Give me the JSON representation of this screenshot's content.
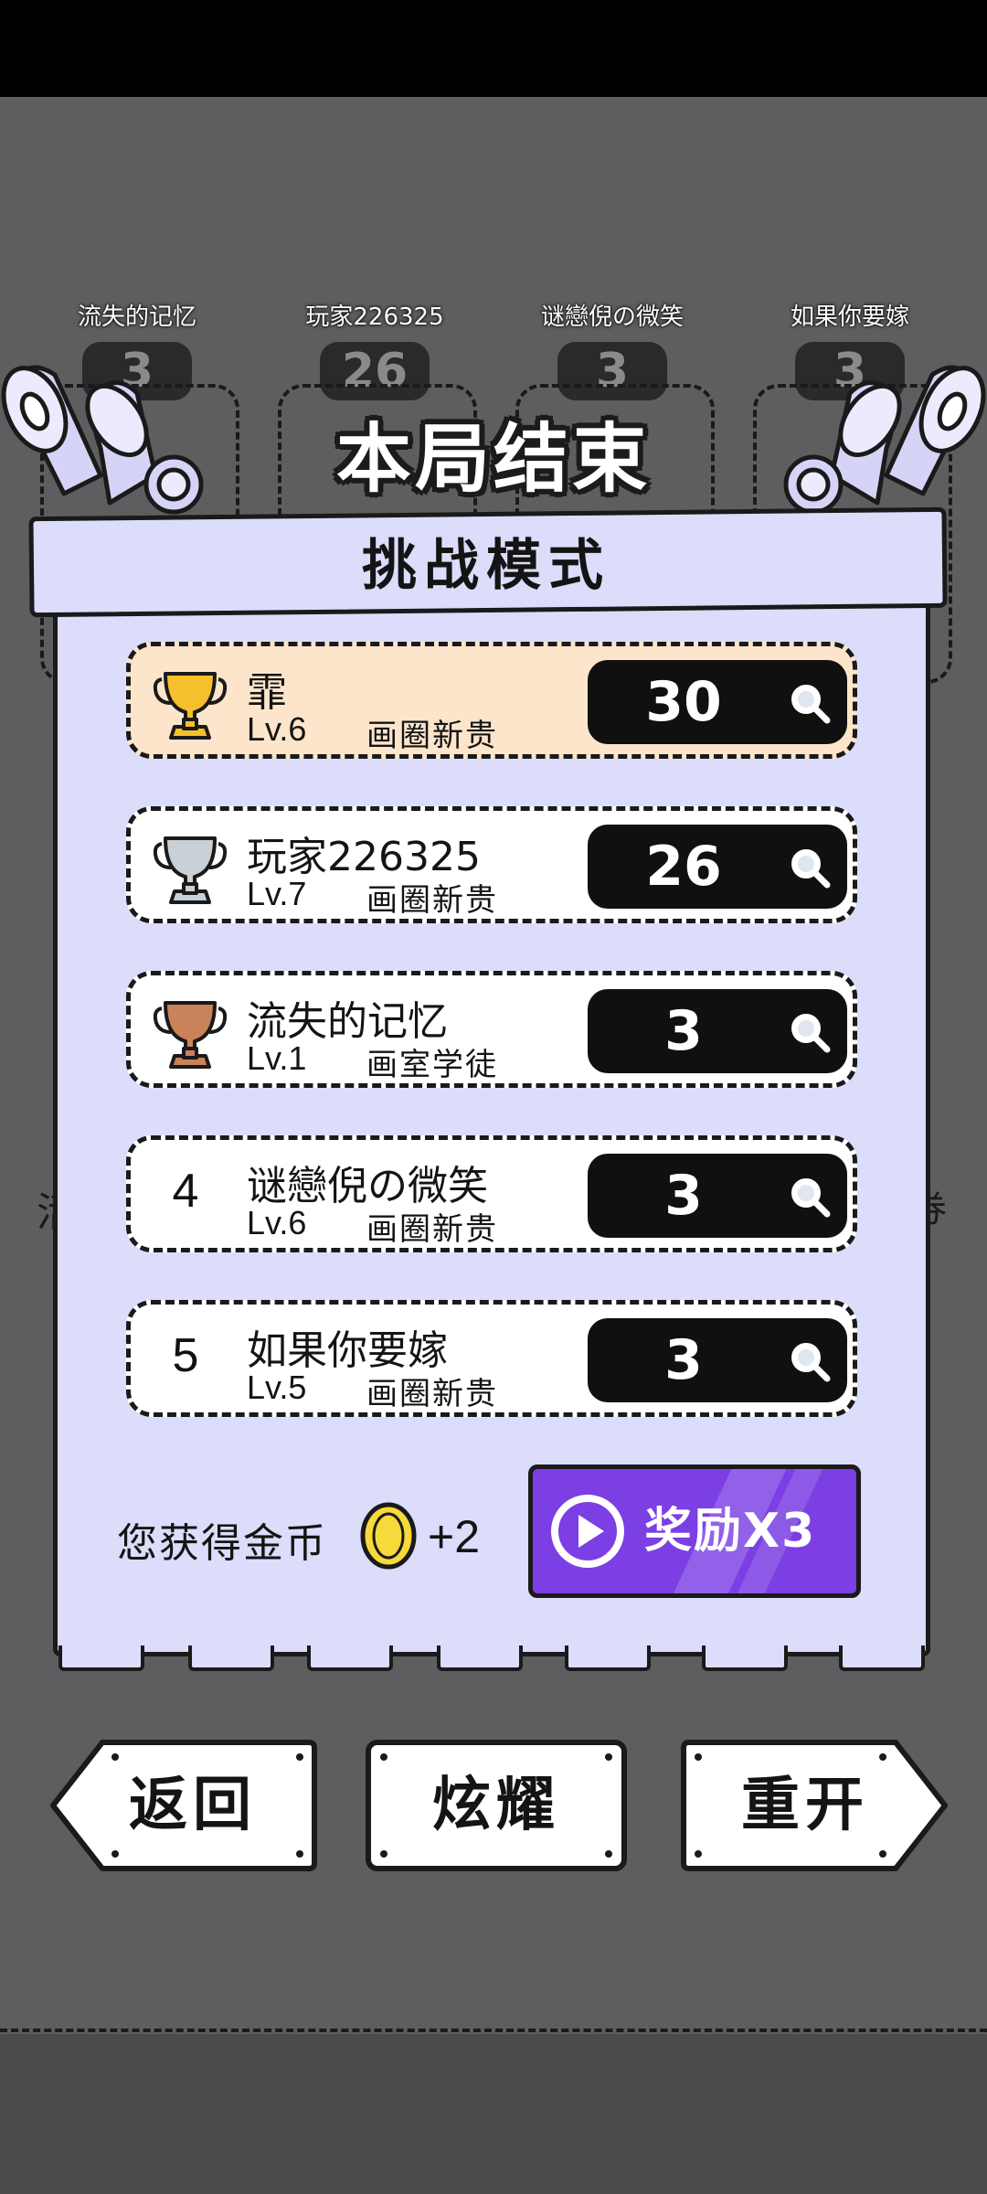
{
  "header": {
    "result_title": "本局结束"
  },
  "background_players": [
    {
      "name": "流失的记忆",
      "score": "3"
    },
    {
      "name": "玩家226325",
      "score": "26"
    },
    {
      "name": "谜戀倪の微笑",
      "score": "3"
    },
    {
      "name": "如果你要嫁",
      "score": "3"
    }
  ],
  "panel": {
    "mode_title": "挑战模式",
    "rankings": [
      {
        "rank": "1",
        "trophy": "gold-trophy-icon",
        "name": "霏",
        "level": "Lv.6",
        "title": "画圈新贵",
        "score": "30"
      },
      {
        "rank": "2",
        "trophy": "silver-trophy-icon",
        "name": "玩家226325",
        "level": "Lv.7",
        "title": "画圈新贵",
        "score": "26"
      },
      {
        "rank": "3",
        "trophy": "bronze-trophy-icon",
        "name": "流失的记忆",
        "level": "Lv.1",
        "title": "画室学徒",
        "score": "3"
      },
      {
        "rank": "4",
        "trophy": "",
        "name": "谜戀倪の微笑",
        "level": "Lv.6",
        "title": "画圈新贵",
        "score": "3"
      },
      {
        "rank": "5",
        "trophy": "",
        "name": "如果你要嫁",
        "level": "Lv.5",
        "title": "画圈新贵",
        "score": "3"
      }
    ],
    "coins_label": "您获得金币",
    "coins_value": "+2",
    "reward_button": "奖励X3"
  },
  "side_fragments": {
    "left": "活",
    "right": "券"
  },
  "footer": {
    "back_label": "返回",
    "share_label": "炫耀",
    "restart_label": "重开"
  },
  "colors": {
    "background": "#5e5e60",
    "panel": "#dcdcfb",
    "first_row": "#fde5cb",
    "reward_button": "#7b3fe4",
    "gold": "#f5c02c",
    "silver": "#c9d0d6",
    "bronze": "#c9825a"
  }
}
